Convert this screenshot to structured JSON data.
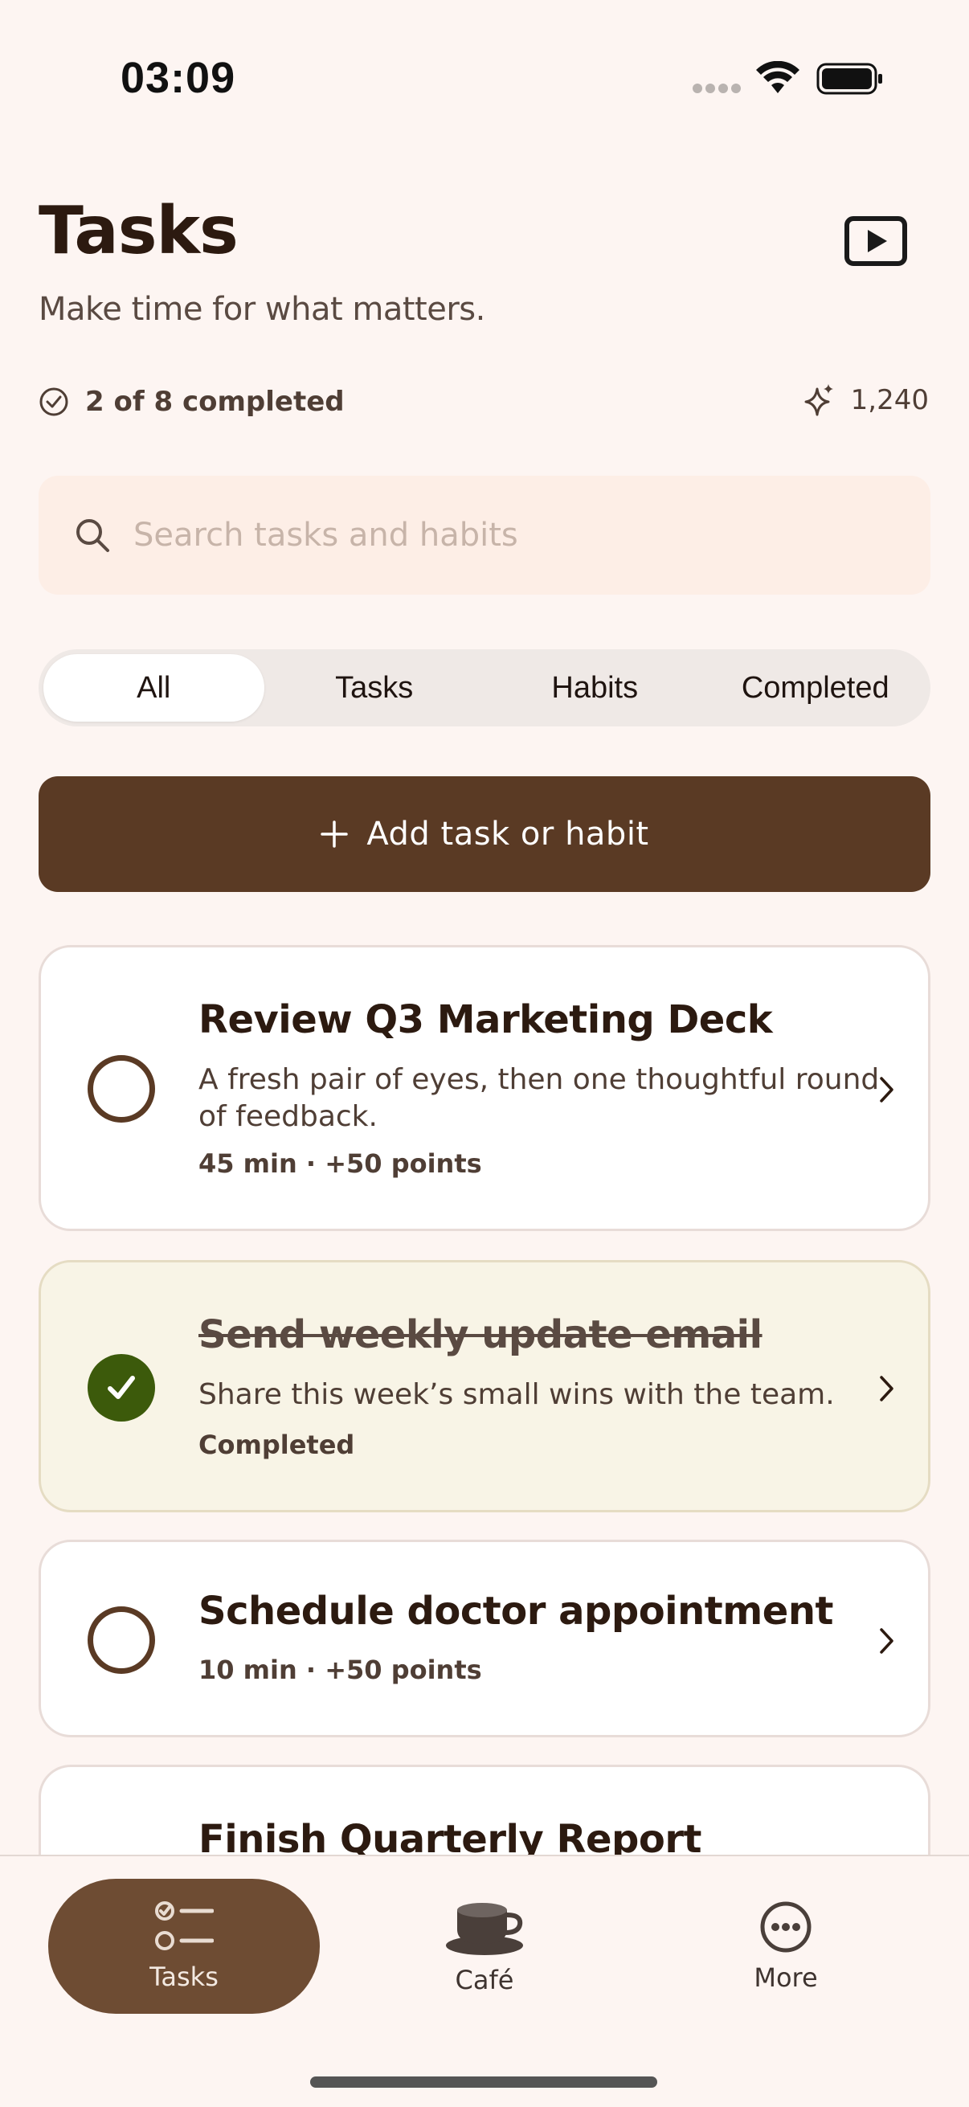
{
  "status_bar": {
    "time": "03:09"
  },
  "header": {
    "title": "Tasks",
    "subtitle": "Make time for what matters.",
    "progress": "2 of 8 completed",
    "points": "1,240"
  },
  "search": {
    "placeholder": "Search tasks and habits"
  },
  "filters": {
    "all": "All",
    "tasks": "Tasks",
    "habits": "Habits",
    "completed": "Completed",
    "selected": "All"
  },
  "add_button": {
    "label": "Add task or habit"
  },
  "tasks": [
    {
      "title": "Review Q3 Marketing Deck",
      "description": "A fresh pair of eyes, then one thoughtful round of feedback.",
      "meta": "45 min · +50 points",
      "completed": false
    },
    {
      "title": "Send weekly update email",
      "description": "Share this week’s small wins with the team.",
      "meta": "Completed",
      "completed": true
    },
    {
      "title": "Schedule doctor appointment",
      "meta": "10 min · +50 points",
      "completed": false
    },
    {
      "title": "Finish Quarterly Report",
      "completed": false
    }
  ],
  "tab_bar": {
    "tasks": "Tasks",
    "cafe": "Café",
    "more": "More",
    "selected": "Tasks"
  },
  "colors": {
    "accent": "#5a3a24",
    "tab_active": "#6e4c33",
    "done_check": "#3c5a0b",
    "background": "#fdf5f2"
  }
}
